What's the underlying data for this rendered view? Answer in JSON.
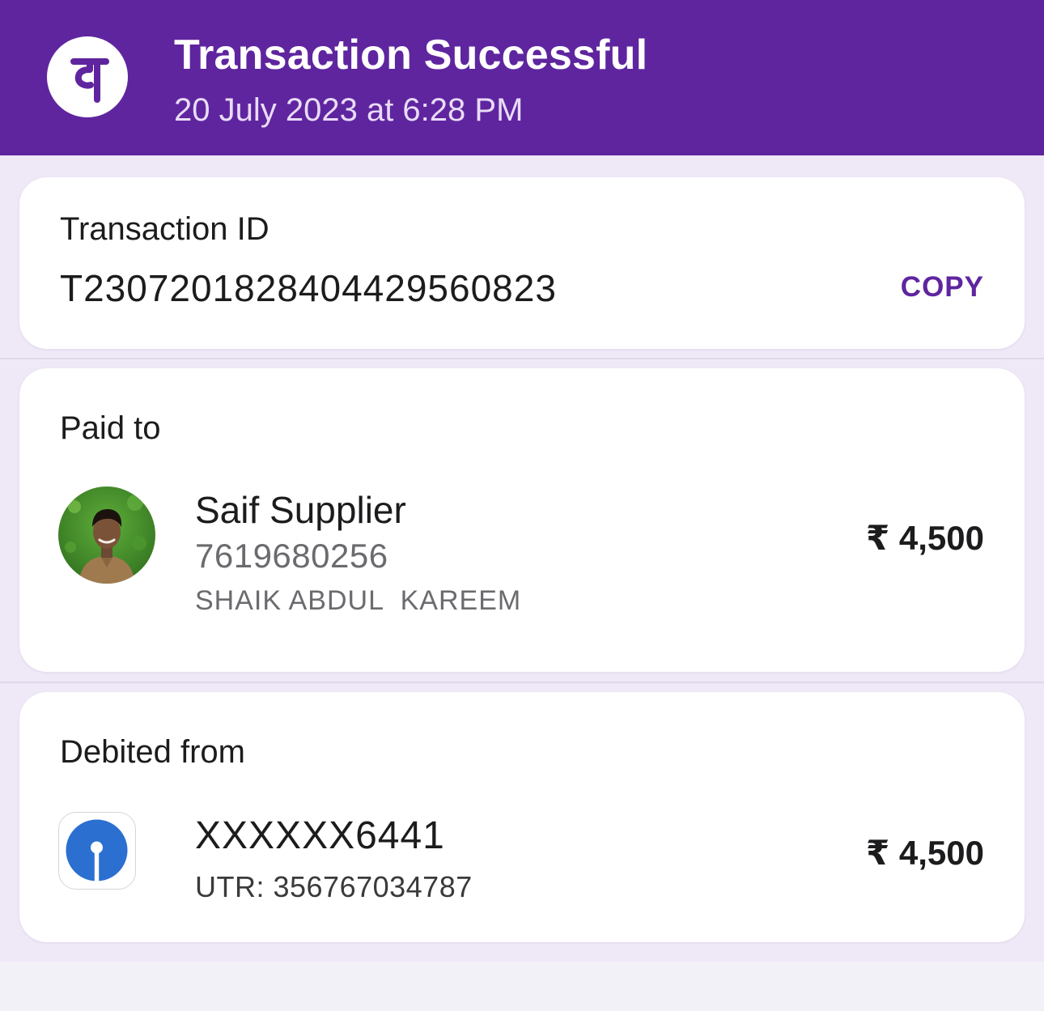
{
  "header": {
    "logo_icon": "phonepe-logo-icon",
    "title": "Transaction Successful",
    "datetime": "20 July 2023 at 6:28 PM"
  },
  "transaction": {
    "label": "Transaction ID",
    "id": "T2307201828404429560823",
    "copy_label": "COPY"
  },
  "paid_to": {
    "label": "Paid to",
    "avatar_icon": "payee-avatar",
    "name": "Saif Supplier",
    "phone": "7619680256",
    "legal_name": "SHAIK ABDUL  KAREEM",
    "amount": "₹ 4,500"
  },
  "debited_from": {
    "label": "Debited from",
    "bank_icon": "sbi-bank-logo-icon",
    "account": "XXXXXX6441",
    "utr": "UTR: 356767034787",
    "amount": "₹ 4,500"
  },
  "colors": {
    "brand": "#5f259f",
    "background": "#efe8f7",
    "card": "#ffffff",
    "bank_blue": "#2b6fd1"
  }
}
